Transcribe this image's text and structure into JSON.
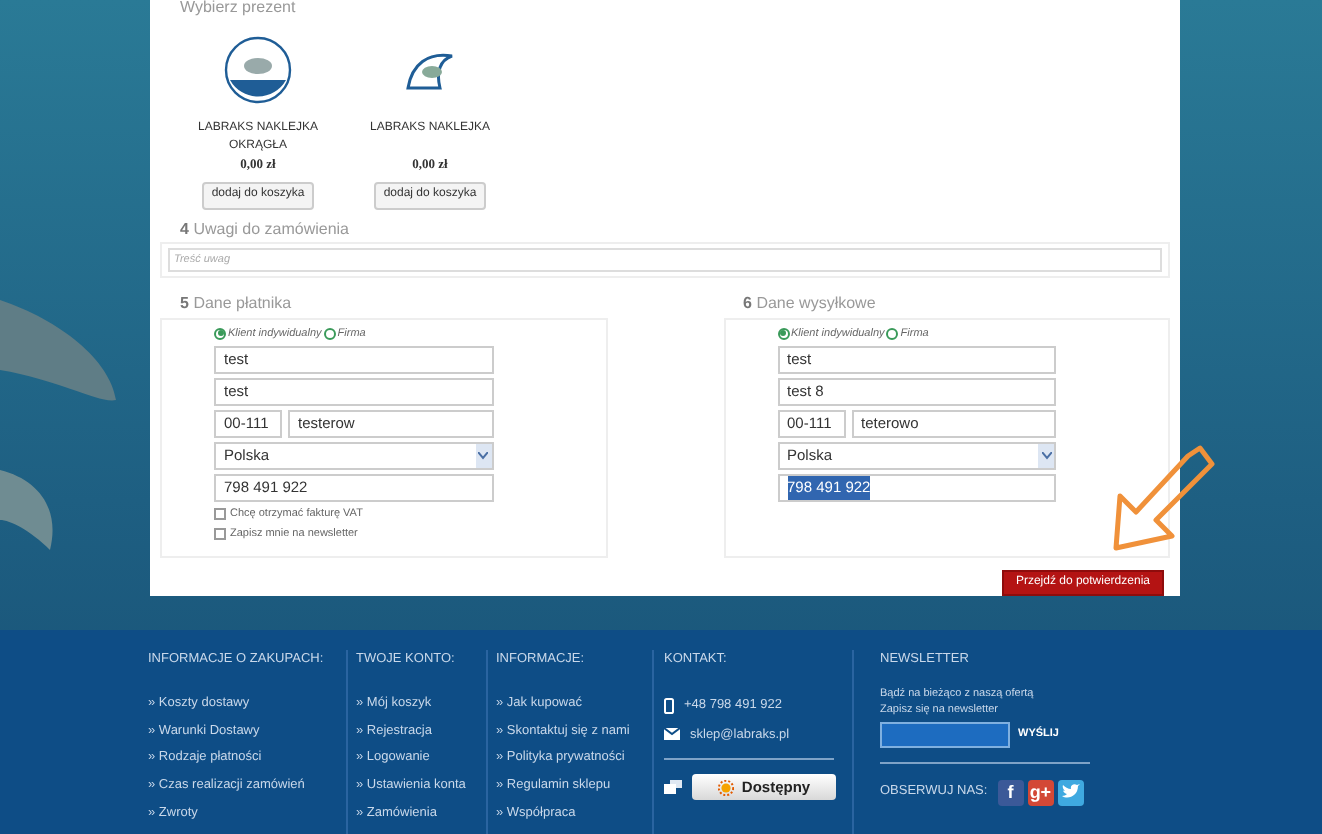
{
  "gifts": {
    "legend": "Wybierz prezent",
    "items": [
      {
        "name": "LABRAKS NAKLEJKA OKRĄGŁA",
        "price": "0,00 zł",
        "button": "dodaj do koszyka",
        "kind": "round"
      },
      {
        "name": "LABRAKS NAKLEJKA",
        "price": "0,00 zł",
        "button": "dodaj do koszyka",
        "kind": "wave"
      }
    ]
  },
  "notes": {
    "number": "4",
    "legend": "Uwagi do zamówienia",
    "placeholder": "Treść uwag"
  },
  "forms": [
    {
      "number": "5",
      "legend": "Dane płatnika",
      "radios": [
        {
          "label": "Klient indywidualny",
          "selected": true
        },
        {
          "label": "Firma",
          "selected": false
        }
      ],
      "fields": [
        {
          "kind": "text",
          "value": "test",
          "highlighted": false
        },
        {
          "kind": "text",
          "value": "test",
          "highlighted": false
        },
        {
          "kind": "pair",
          "value": "00-111",
          "value2": "testerow",
          "highlighted": false
        },
        {
          "kind": "select",
          "value": "Polska",
          "highlighted": false
        },
        {
          "kind": "text",
          "value": "798 491 922",
          "highlighted": false
        }
      ],
      "checkboxes": [
        {
          "label": "Chcę otrzymać fakturę VAT",
          "checked": false
        },
        {
          "label": "Zapisz mnie na newsletter",
          "checked": false
        }
      ]
    },
    {
      "number": "6",
      "legend": "Dane wysyłkowe",
      "radios": [
        {
          "label": "Klient indywidualny",
          "selected": true
        },
        {
          "label": "Firma",
          "selected": false
        }
      ],
      "fields": [
        {
          "kind": "text",
          "value": "test",
          "highlighted": false
        },
        {
          "kind": "text",
          "value": "test 8",
          "highlighted": false
        },
        {
          "kind": "pair",
          "value": "00-111",
          "value2": "teterowo",
          "highlighted": false
        },
        {
          "kind": "select",
          "value": "Polska",
          "highlighted": false
        },
        {
          "kind": "text",
          "value": "798 491 922",
          "highlighted": true
        }
      ]
    }
  ],
  "submit": "Przejdź do potwierdzenia",
  "footer": {
    "columns": [
      {
        "heading": "INFORMACJE O ZAKUPACH:",
        "links": [
          "» Koszty dostawy",
          "» Warunki Dostawy",
          "» Rodzaje płatności",
          "» Czas realizacji zamówień",
          "» Zwroty"
        ]
      },
      {
        "heading": "TWOJE KONTO:",
        "links": [
          "» Mój koszyk",
          "» Rejestracja",
          "» Logowanie",
          "» Ustawienia konta",
          "» Zamówienia"
        ]
      },
      {
        "heading": "INFORMACJE:",
        "links": [
          "» Jak kupować",
          "» Skontaktuj się z nami",
          "» Polityka prywatności",
          "» Regulamin sklepu",
          "» Współpraca"
        ]
      }
    ],
    "contact": {
      "heading": "KONTAKT:",
      "phone": "+48 798 491 922",
      "email": "sklep@labraks.pl",
      "status": "Dostępny"
    },
    "newsletter": {
      "heading": "NEWSLETTER",
      "text": "Bądź na bieżąco z naszą ofertą",
      "text2": "Zapisz się na newsletter",
      "button": "WYŚLIJ",
      "follow": "OBSERWUJ NAS:",
      "socials": [
        {
          "kind": "facebook",
          "label": "f"
        },
        {
          "kind": "googleplus",
          "label": "g+"
        },
        {
          "kind": "twitter"
        }
      ]
    }
  }
}
